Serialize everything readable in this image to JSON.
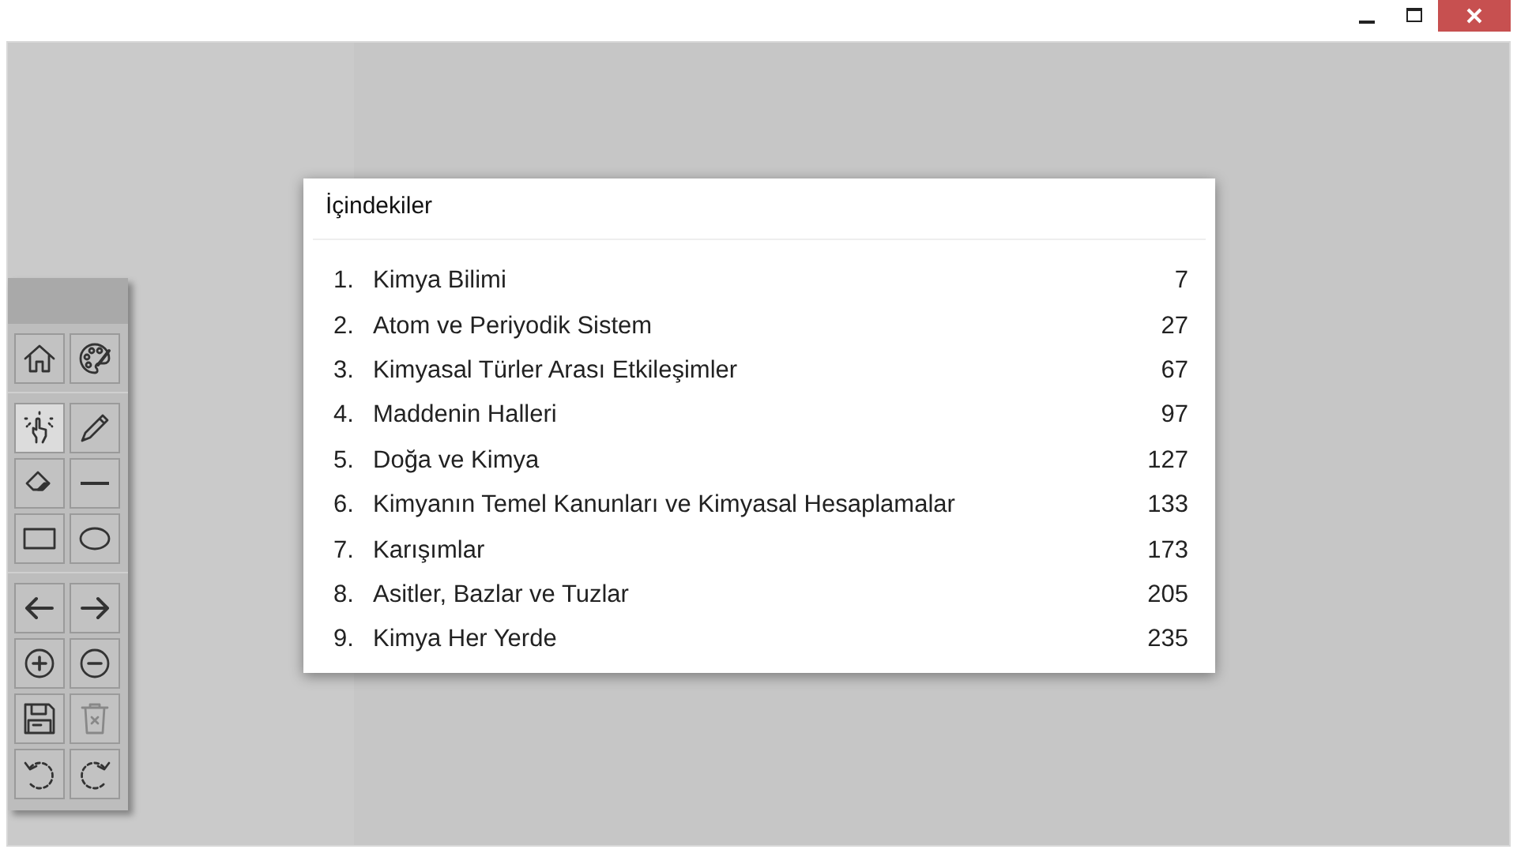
{
  "window": {
    "controls": [
      {
        "kind": "minimize"
      },
      {
        "kind": "maximize"
      },
      {
        "kind": "close"
      }
    ]
  },
  "toolbar": {
    "groups": [
      [
        {
          "kind": "home",
          "selected": false
        },
        {
          "kind": "palette",
          "selected": false
        }
      ],
      [
        {
          "kind": "hand",
          "selected": true
        },
        {
          "kind": "pen",
          "selected": false
        },
        {
          "kind": "eraser",
          "selected": false
        },
        {
          "kind": "line",
          "selected": false
        },
        {
          "kind": "rectangle",
          "selected": false
        },
        {
          "kind": "ellipse",
          "selected": false
        }
      ],
      [
        {
          "kind": "arrow-left",
          "selected": false
        },
        {
          "kind": "arrow-right",
          "selected": false
        },
        {
          "kind": "zoom-in",
          "selected": false
        },
        {
          "kind": "zoom-out",
          "selected": false
        },
        {
          "kind": "save",
          "selected": false
        },
        {
          "kind": "trash",
          "selected": false
        },
        {
          "kind": "undo",
          "selected": false
        },
        {
          "kind": "redo",
          "selected": false
        }
      ]
    ]
  },
  "dialog": {
    "title": "İçindekiler",
    "entries": [
      {
        "number": "1.",
        "title": "Kimya Bilimi",
        "page": "7"
      },
      {
        "number": "2.",
        "title": "Atom ve Periyodik Sistem",
        "page": "27"
      },
      {
        "number": "3.",
        "title": "Kimyasal Türler Arası Etkileşimler",
        "page": "67"
      },
      {
        "number": "4.",
        "title": "Maddenin Halleri",
        "page": "97"
      },
      {
        "number": "5.",
        "title": "Doğa ve Kimya",
        "page": "127"
      },
      {
        "number": "6.",
        "title": "Kimyanın Temel Kanunları ve Kimyasal Hesaplamalar",
        "page": "133"
      },
      {
        "number": "7.",
        "title": "Karışımlar",
        "page": "173"
      },
      {
        "number": "8.",
        "title": "Asitler, Bazlar ve Tuzlar",
        "page": "205"
      },
      {
        "number": "9.",
        "title": "Kimya Her Yerde",
        "page": "235"
      }
    ]
  }
}
